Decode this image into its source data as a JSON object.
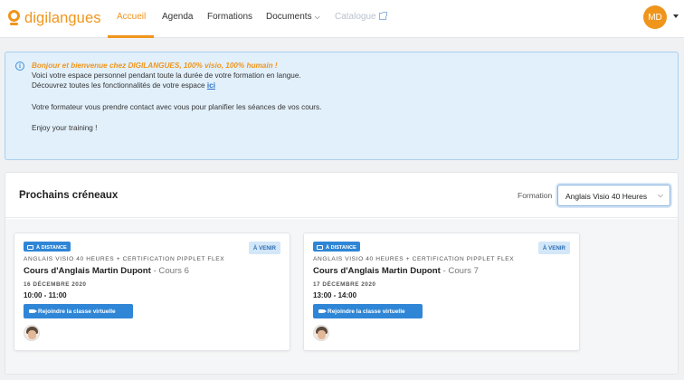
{
  "brand": {
    "name": "digilangues"
  },
  "nav": {
    "items": [
      {
        "label": "Accueil",
        "active": true
      },
      {
        "label": "Agenda"
      },
      {
        "label": "Formations"
      },
      {
        "label": "Documents",
        "has_dropdown": true
      },
      {
        "label": "Catalogue",
        "disabled": true,
        "external": true
      }
    ],
    "user_initials": "MD"
  },
  "banner": {
    "title": "Bonjour et bienvenue chez DIGILANGUES, 100% visio, 100% humain !",
    "line1": "Voici votre espace personnel pendant toute la durée de votre formation en langue.",
    "line2_prefix": "Découvrez toutes les fonctionnalités de votre espace ",
    "line2_link": "ici",
    "line3": "Votre formateur vous prendre contact avec vous pour planifier les séances de vos cours.",
    "line4": "Enjoy your training !"
  },
  "slots": {
    "title": "Prochains créneaux",
    "formation_label": "Formation",
    "formation_selected": "Anglais Visio 40 Heures",
    "cards": [
      {
        "mode": "À DISTANCE",
        "status": "À VENIR",
        "program": "ANGLAIS VISIO 40 HEURES + CERTIFICATION PIPPLET FLEX",
        "course": "Cours d'Anglais Martin Dupont",
        "session": "- Cours 6",
        "date": "16 DÉCEMBRE 2020",
        "time": "10:00 - 11:00",
        "join_label": "Rejoindre la classe virtuelle"
      },
      {
        "mode": "À DISTANCE",
        "status": "À VENIR",
        "program": "ANGLAIS VISIO 40 HEURES + CERTIFICATION PIPPLET FLEX",
        "course": "Cours d'Anglais Martin Dupont",
        "session": "- Cours 7",
        "date": "17 DÉCEMBRE 2020",
        "time": "13:00 - 14:00",
        "join_label": "Rejoindre la classe virtuelle"
      }
    ]
  },
  "colors": {
    "accent": "#f0951c",
    "primary": "#2f86d6",
    "banner_bg": "#e2f0fb"
  },
  "icons": [
    "location-pin-icon",
    "chevron-down-icon",
    "external-link-icon",
    "info-icon",
    "screen-icon",
    "video-camera-icon"
  ]
}
